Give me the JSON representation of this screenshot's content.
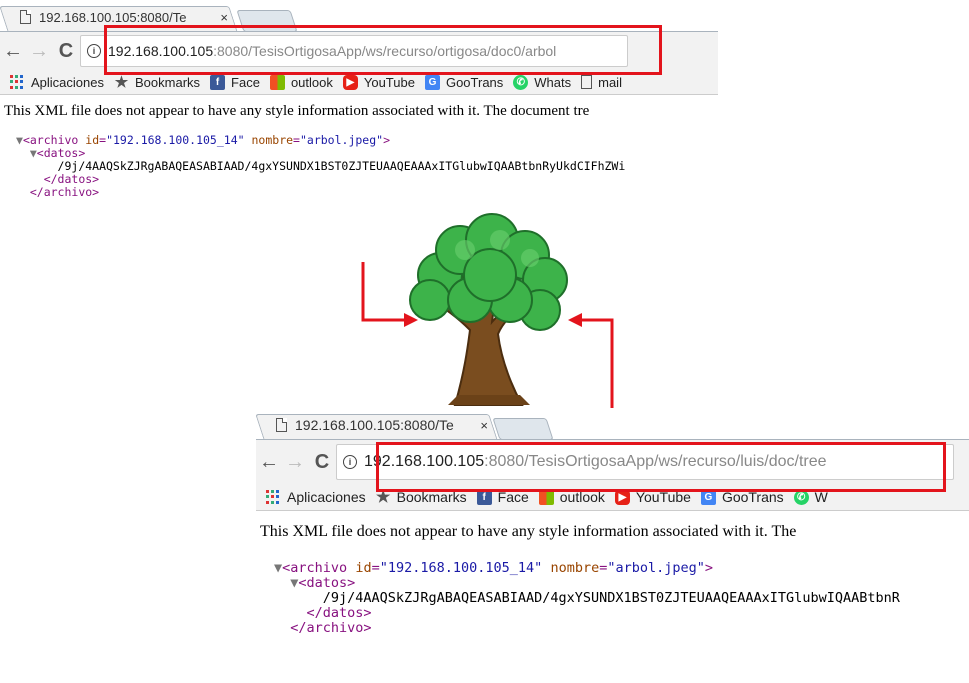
{
  "window_top": {
    "tab_title": "192.168.100.105:8080/Te",
    "tab_close": "×",
    "url_host": "192.168.100.105",
    "url_path": ":8080/TesisOrtigosaApp/ws/recurso/ortigosa/doc0/arbol",
    "bookmarks": [
      "Aplicaciones",
      "Bookmarks",
      "Face",
      "outlook",
      "YouTube",
      "GooTrans",
      "Whats",
      "mail"
    ],
    "notice": "This XML file does not appear to have any style information associated with it. The document tre",
    "xml": {
      "root_open_tag": "archivo",
      "id_attr": "id",
      "id_value": "\"192.168.100.105_14\"",
      "name_attr": "nombre",
      "name_value": "\"arbol.jpeg\"",
      "child_tag": "<datos>",
      "data": "/9j/4AAQSkZJRgABAQEASABIAAD/4gxYSUNDX1BST0ZJTEUAAQEAAAxITGlubwIQAABtbnRyUkdCIFhZWi",
      "child_close": "</datos>",
      "root_close": "</archivo>"
    }
  },
  "window_bottom": {
    "tab_title": "192.168.100.105:8080/Te",
    "tab_close": "×",
    "url_host": "192.168.100.105",
    "url_path": ":8080/TesisOrtigosaApp/ws/recurso/luis/doc/tree",
    "bookmarks": [
      "Aplicaciones",
      "Bookmarks",
      "Face",
      "outlook",
      "YouTube",
      "GooTrans",
      "W"
    ],
    "notice": "This XML file does not appear to have any style information associated with it. The",
    "xml": {
      "root_open_tag": "archivo",
      "id_attr": "id",
      "id_value": "\"192.168.100.105_14\"",
      "name_attr": "nombre",
      "name_value": "\"arbol.jpeg\"",
      "child_tag": "<datos>",
      "data": "/9j/4AAQSkZJRgABAQEASABIAAD/4gxYSUNDX1BST0ZJTEUAAQEAAAxITGlubwIQAABtbnR",
      "child_close": "</datos>",
      "root_close": "</archivo>"
    }
  },
  "icons": {
    "back": "back-arrow-icon",
    "forward": "forward-arrow-icon",
    "reload": "reload-icon",
    "info": "info-icon",
    "tree": "tree-image"
  },
  "colors": {
    "highlight": "#e3141c",
    "arrow": "#e3141c",
    "foliage": "#3db34a",
    "trunk": "#7a4d1f"
  }
}
